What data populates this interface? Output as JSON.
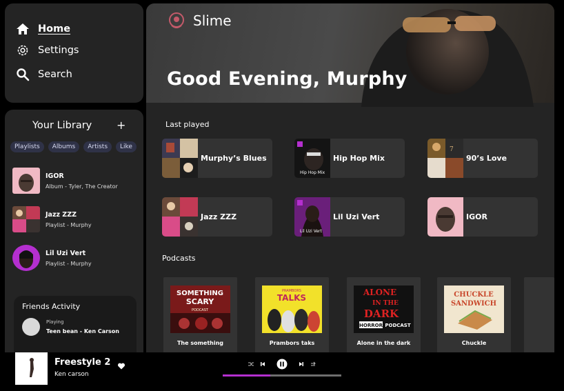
{
  "nav": {
    "home": "Home",
    "settings": "Settings",
    "search": "Search"
  },
  "library": {
    "title": "Your Library",
    "add": "+",
    "chips": [
      "Playlists",
      "Albums",
      "Artists",
      "Like"
    ],
    "items": [
      {
        "name": "IGOR",
        "sub": "Album - Tyler, The Creator"
      },
      {
        "name": "Jazz ZZZ",
        "sub": "Playlist - Murphy"
      },
      {
        "name": "Lil Uzi Vert",
        "sub": "Playlist - Murphy"
      }
    ]
  },
  "friends": {
    "title": "Friends Activity",
    "status": "Playing",
    "track": "Teen bean - Ken Carson"
  },
  "header": {
    "app_name": "Slime",
    "greeting": "Good Evening, Murphy"
  },
  "last_played": {
    "title": "Last played",
    "tiles": [
      {
        "name": "Murphy’s Blues"
      },
      {
        "name": "Hip Hop Mix",
        "art_caption": "Hip Hop Mix"
      },
      {
        "name": "90’s Love"
      },
      {
        "name": "Jazz ZZZ"
      },
      {
        "name": "Lil Uzi Vert",
        "art_caption": "Lil Uzi Vert"
      },
      {
        "name": "IGOR"
      }
    ]
  },
  "podcasts": {
    "title": "Podcasts",
    "items": [
      {
        "title": "The something",
        "cover_text": [
          "SOMETHING",
          "SCARY",
          "PODCAST"
        ]
      },
      {
        "title": "Prambors taks",
        "cover_text": [
          "PRAMBORS",
          "TALKS"
        ]
      },
      {
        "title": "Alone in the dark",
        "cover_text": [
          "ALONE",
          "IN THE",
          "DARK",
          "HORROR",
          "PODCAST"
        ]
      },
      {
        "title": "Chuckle",
        "cover_text": [
          "CHUCKLE",
          "SANDWICH"
        ]
      }
    ]
  },
  "player": {
    "title": "Freestyle 2",
    "artist": "Ken carson",
    "progress": 0.4
  },
  "colors": {
    "accent": "#b42fcf",
    "panel": "#242424",
    "tile": "#333333",
    "chip": "#2f3247"
  }
}
